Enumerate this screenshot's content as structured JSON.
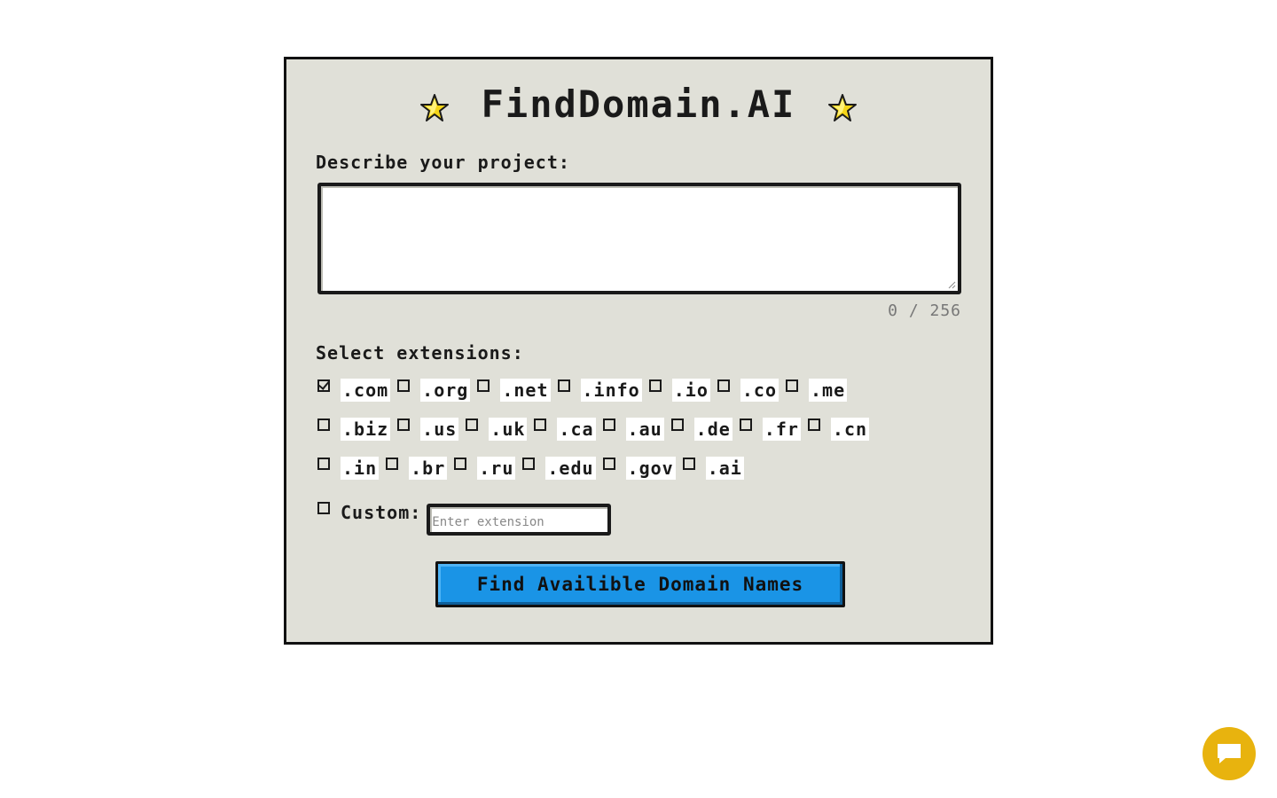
{
  "app": {
    "title": "FindDomain.AI",
    "star_icon": "star-icon"
  },
  "project": {
    "label": "Describe your project:",
    "value": "",
    "counter": "0 / 256"
  },
  "extensions": {
    "label": "Select extensions:",
    "rows": [
      [
        {
          "label": ".com",
          "checked": true
        },
        {
          "label": ".org",
          "checked": false
        },
        {
          "label": ".net",
          "checked": false
        },
        {
          "label": ".info",
          "checked": false
        },
        {
          "label": ".io",
          "checked": false
        },
        {
          "label": ".co",
          "checked": false
        },
        {
          "label": ".me",
          "checked": false
        }
      ],
      [
        {
          "label": ".biz",
          "checked": false
        },
        {
          "label": ".us",
          "checked": false
        },
        {
          "label": ".uk",
          "checked": false
        },
        {
          "label": ".ca",
          "checked": false
        },
        {
          "label": ".au",
          "checked": false
        },
        {
          "label": ".de",
          "checked": false
        },
        {
          "label": ".fr",
          "checked": false
        },
        {
          "label": ".cn",
          "checked": false
        }
      ],
      [
        {
          "label": ".in",
          "checked": false
        },
        {
          "label": ".br",
          "checked": false
        },
        {
          "label": ".ru",
          "checked": false
        },
        {
          "label": ".edu",
          "checked": false
        },
        {
          "label": ".gov",
          "checked": false
        },
        {
          "label": ".ai",
          "checked": false
        }
      ]
    ],
    "custom": {
      "label": "Custom:",
      "checked": false,
      "value": "",
      "placeholder": "Enter extension"
    }
  },
  "actions": {
    "find_label": "Find Availible Domain Names"
  },
  "chat": {
    "icon": "chat-bubble-icon"
  },
  "colors": {
    "card_bg": "#e0e0d8",
    "button_bg": "#1a94e6",
    "chat_bg": "#e8b30e",
    "star_fill": "#f5d518"
  }
}
